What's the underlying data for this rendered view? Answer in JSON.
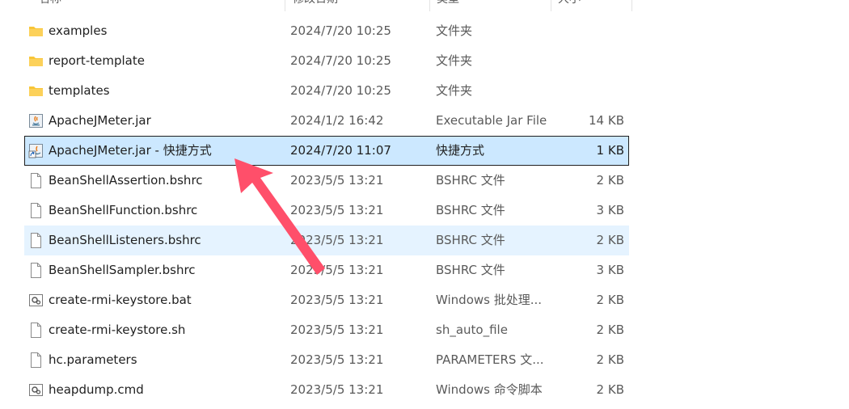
{
  "columns": {
    "name": "名称",
    "date": "修改日期",
    "type": "类型",
    "size": "大小"
  },
  "files": [
    {
      "name": "examples",
      "date": "2024/7/20 10:25",
      "type": "文件夹",
      "size": "",
      "icon": "folder-icon"
    },
    {
      "name": "report-template",
      "date": "2024/7/20 10:25",
      "type": "文件夹",
      "size": "",
      "icon": "folder-icon"
    },
    {
      "name": "templates",
      "date": "2024/7/20 10:25",
      "type": "文件夹",
      "size": "",
      "icon": "folder-icon"
    },
    {
      "name": "ApacheJMeter.jar",
      "date": "2024/1/2 16:42",
      "type": "Executable Jar File",
      "size": "14 KB",
      "icon": "jar-icon"
    },
    {
      "name": "ApacheJMeter.jar - 快捷方式",
      "date": "2024/7/20 11:07",
      "type": "快捷方式",
      "size": "1 KB",
      "icon": "jar-shortcut-icon",
      "state": "selected"
    },
    {
      "name": "BeanShellAssertion.bshrc",
      "date": "2023/5/5 13:21",
      "type": "BSHRC 文件",
      "size": "2 KB",
      "icon": "file-icon"
    },
    {
      "name": "BeanShellFunction.bshrc",
      "date": "2023/5/5 13:21",
      "type": "BSHRC 文件",
      "size": "3 KB",
      "icon": "file-icon"
    },
    {
      "name": "BeanShellListeners.bshrc",
      "date": "2023/5/5 13:21",
      "type": "BSHRC 文件",
      "size": "2 KB",
      "icon": "file-icon",
      "state": "hover"
    },
    {
      "name": "BeanShellSampler.bshrc",
      "date": "2023/5/5 13:21",
      "type": "BSHRC 文件",
      "size": "3 KB",
      "icon": "file-icon"
    },
    {
      "name": "create-rmi-keystore.bat",
      "date": "2023/5/5 13:21",
      "type": "Windows 批处理...",
      "size": "2 KB",
      "icon": "batch-file-icon"
    },
    {
      "name": "create-rmi-keystore.sh",
      "date": "2023/5/5 13:21",
      "type": "sh_auto_file",
      "size": "2 KB",
      "icon": "file-icon"
    },
    {
      "name": "hc.parameters",
      "date": "2023/5/5 13:21",
      "type": "PARAMETERS 文...",
      "size": "2 KB",
      "icon": "file-icon"
    },
    {
      "name": "heapdump.cmd",
      "date": "2023/5/5 13:21",
      "type": "Windows 命令脚本",
      "size": "2 KB",
      "icon": "batch-file-icon"
    }
  ],
  "colors": {
    "selected_bg": "#cce8ff",
    "hover_bg": "#e5f3ff",
    "folder": "#f8c537",
    "arrow": "#ff4f6a"
  },
  "annotation": {
    "icon": "red-arrow-icon"
  }
}
